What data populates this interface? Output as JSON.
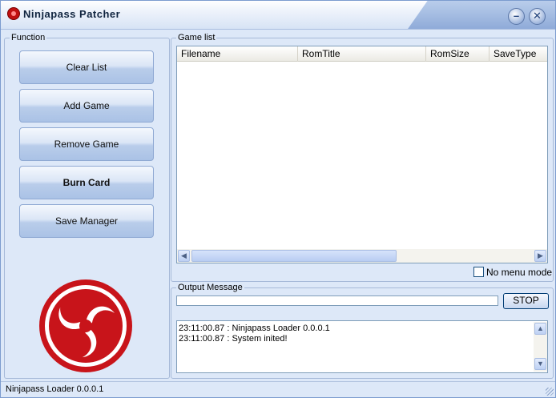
{
  "window": {
    "title": "Ninjapass Patcher"
  },
  "function_group": {
    "legend": "Function",
    "buttons": {
      "clear_list": "Clear List",
      "add_game": "Add Game",
      "remove_game": "Remove Game",
      "burn_card": "Burn Card",
      "save_manager": "Save Manager"
    }
  },
  "game_list": {
    "legend": "Game list",
    "columns": [
      "Filename",
      "RomTitle",
      "RomSize",
      "SaveType"
    ],
    "rows": [],
    "no_menu_mode_label": "No menu mode",
    "no_menu_mode_checked": false
  },
  "output": {
    "legend": "Output Message",
    "stop_label": "STOP",
    "log": [
      "23:11:00.87 : Ninjapass Loader 0.0.0.1",
      "23:11:00.87 : System inited!"
    ]
  },
  "statusbar": {
    "text": "Ninjapass Loader 0.0.0.1"
  },
  "icons": {
    "app": "app-logo-icon",
    "minimize": "minimize-icon",
    "close": "close-icon"
  },
  "colors": {
    "logo_red": "#c8141a",
    "window_bg": "#dde8f8",
    "accent": "#7c9ccf"
  }
}
